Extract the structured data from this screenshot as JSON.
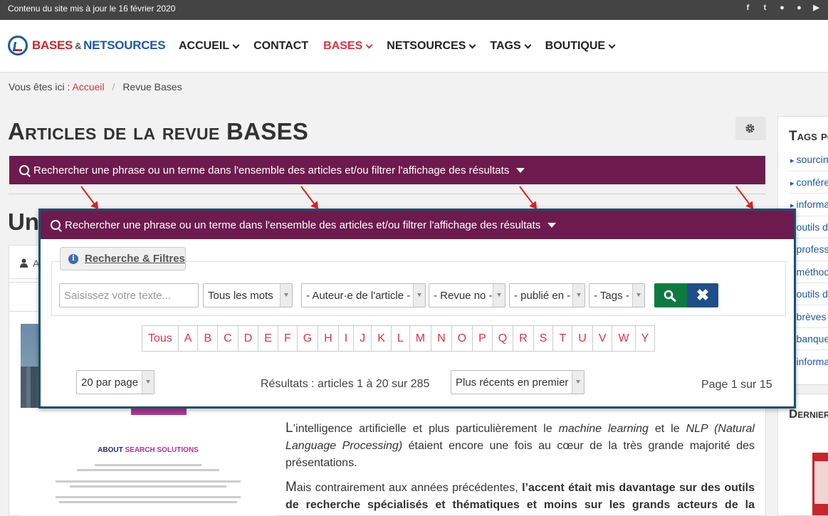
{
  "topbar": {
    "text": "Contenu du site mis à jour le 16 février 2020",
    "icons": [
      "facebook-icon",
      "twitter-icon",
      "bullet-icon",
      "bullet-icon",
      "youtube-icon"
    ]
  },
  "header": {
    "logo": {
      "part1": "BASES",
      "amp": "&",
      "part2": "NETSOURCES"
    },
    "nav": [
      {
        "label": "ACCUEIL"
      },
      {
        "label": "CONTACT"
      },
      {
        "label": "BASES"
      },
      {
        "label": "NETSOURCES"
      },
      {
        "label": "TAGS"
      },
      {
        "label": "BOUTIQUE"
      }
    ]
  },
  "breadcrumb": {
    "prefix": "Vous êtes ici :",
    "home": "Accueil",
    "separator": "/",
    "current": "Revue Bases"
  },
  "page": {
    "title": "Articles de la revue BASES",
    "under_title": "Un"
  },
  "search_bar": {
    "label": "Rechercher une phrase ou un terme dans l'ensemble des articles et/ou filtrer l'affichage des résultats"
  },
  "filters": {
    "legend": "Recherche & Filtres",
    "text_placeholder": "Saisissez votre texte...",
    "mode": "Tous les mots",
    "author": "- Auteur·e de l'article -",
    "issue": "- Revue no -",
    "published": "- publié en -",
    "tags": "- Tags -",
    "clear_symbol": "✖"
  },
  "letters": [
    "Tous",
    "A",
    "B",
    "C",
    "D",
    "E",
    "F",
    "G",
    "H",
    "I",
    "J",
    "K",
    "L",
    "M",
    "N",
    "O",
    "P",
    "Q",
    "R",
    "S",
    "T",
    "U",
    "V",
    "W",
    "Y"
  ],
  "results": {
    "per_page": "20 par page",
    "summary": "Résultats : articles 1 à 20 sur 285",
    "sort": "Plus récents en premier",
    "page_info": "Page 1 sur 15"
  },
  "tab_stub": "A",
  "thumbnail": {
    "about_prefix": "ABOUT ",
    "about_highlight": "SEARCH SOLUTIONS"
  },
  "article": {
    "p1_cap": "L",
    "p1_a": "’intelligence artificielle et plus particulièrement le ",
    "p1_ml": "machine learning",
    "p1_b": " et le ",
    "p1_nlp": "NLP (Natural Language Processing)",
    "p1_c": " étaient encore une fois au cœur de la très grande majorité des présentations.",
    "p2_cap": "M",
    "p2_a": "ais contrairement aux années précédentes, ",
    "p2_bold": "l’accent était mis davantage sur des outils de recherche spécialisés et thématiques et moins sur les grands acteurs de la recherche Web"
  },
  "sidebar": {
    "title": "Tags populaires",
    "tags": [
      "sourcing",
      "conférences",
      "information",
      "outils de",
      "professionnels",
      "méthodologie",
      "outils de",
      "brèves",
      "banques",
      "information"
    ],
    "latest_title": "Derniers numéros"
  }
}
